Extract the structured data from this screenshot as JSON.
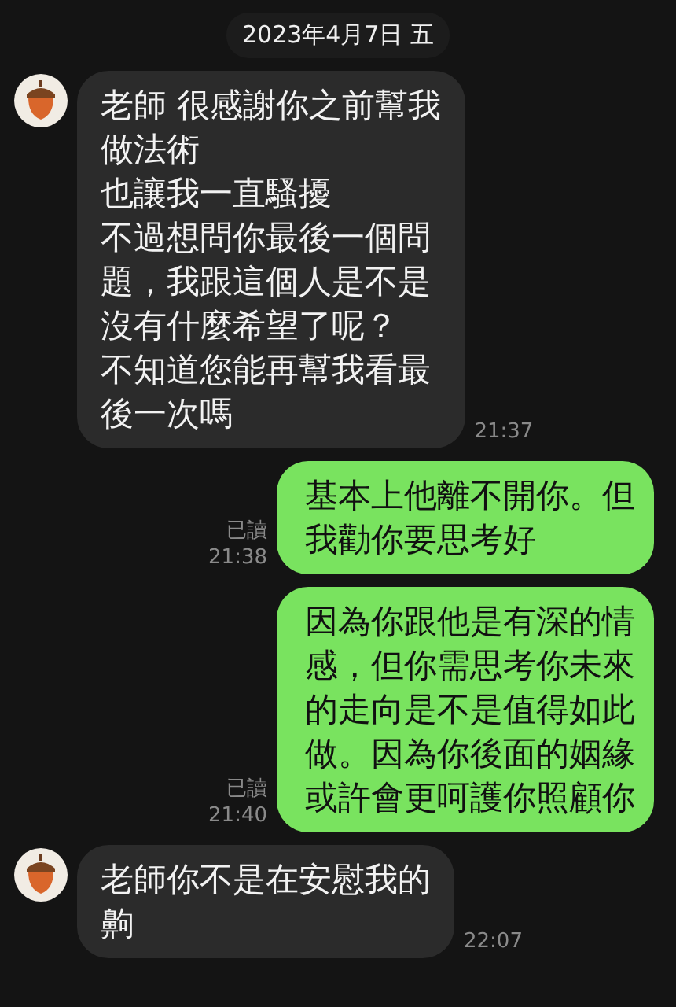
{
  "date_header": "2023年4月7日 五",
  "messages": [
    {
      "kind": "incoming",
      "lines": [
        "老師 很感謝你之前幫我",
        "做法術",
        "也讓我一直騷擾",
        "不過想問你最後一個問",
        "題，我跟這個人是不是",
        "沒有什麼希望了呢？",
        "不知道您能再幫我看最",
        "後一次嗎"
      ],
      "time": "21:37"
    },
    {
      "kind": "outgoing",
      "lines": [
        "基本上他離不開你。但",
        "我勸你要思考好"
      ],
      "read_label": "已讀",
      "time": "21:38"
    },
    {
      "kind": "outgoing",
      "lines": [
        "因為你跟他是有深的情",
        "感，但你需思考你未來",
        "的走向是不是值得如此",
        "做。因為你後面的姻緣",
        "或許會更呵護你照顧你"
      ],
      "read_label": "已讀",
      "time": "21:40"
    },
    {
      "kind": "incoming",
      "lines": [
        "老師你不是在安慰我的",
        "齁"
      ],
      "time": "22:07"
    }
  ]
}
